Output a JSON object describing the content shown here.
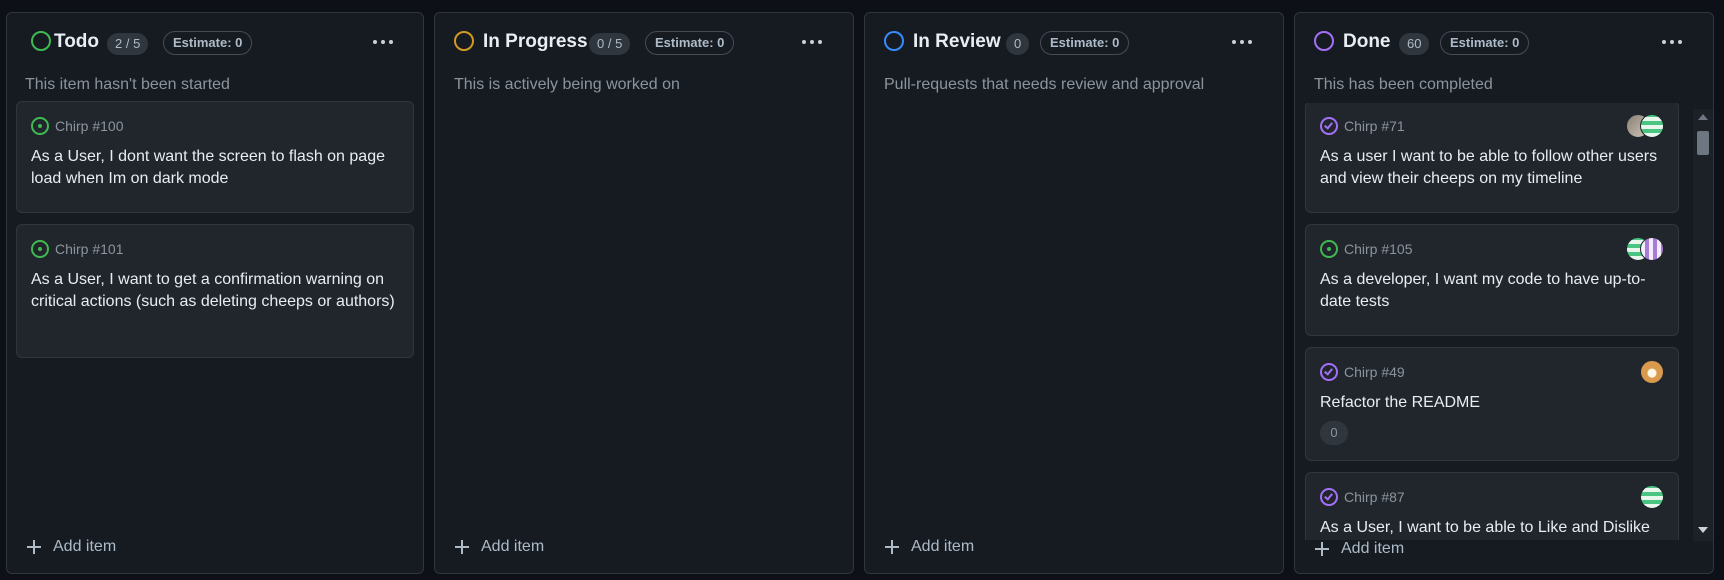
{
  "columns": [
    {
      "title": "Todo",
      "count": "2 / 5",
      "estimate": "Estimate: 0",
      "description": "This item hasn't been started",
      "status_color": "#3fb950",
      "add_label": "Add item",
      "cards": [
        {
          "number": "Chirp #100",
          "title": "As a User, I dont want the screen to flash on page load when Im on dark mode",
          "state": "open"
        },
        {
          "number": "Chirp #101",
          "title": "As a User, I want to get a confirmation warning on critical actions (such as deleting cheeps or authors)",
          "state": "open"
        }
      ]
    },
    {
      "title": "In Progress",
      "count": "0 / 5",
      "estimate": "Estimate: 0",
      "description": "This is actively being worked on",
      "status_color": "#d29922",
      "add_label": "Add item",
      "cards": []
    },
    {
      "title": "In Review",
      "count": "0",
      "estimate": "Estimate: 0",
      "description": "Pull-requests that needs review and approval",
      "status_color": "#388bfd",
      "add_label": "Add item",
      "cards": []
    },
    {
      "title": "Done",
      "count": "60",
      "estimate": "Estimate: 0",
      "description": "This has been completed",
      "status_color": "#a371f7",
      "add_label": "Add item",
      "cards": [
        {
          "number": "Chirp #71",
          "title": "As a user I want to be able to follow other users and view their cheeps on my timeline",
          "state": "done",
          "avatars": [
            "photo",
            "green"
          ]
        },
        {
          "number": "Chirp #105",
          "title": "As a developer, I want my code to have up-to-date tests",
          "state": "open",
          "avatars": [
            "green",
            "purple"
          ]
        },
        {
          "number": "Chirp #49",
          "title": "Refactor the README",
          "state": "done",
          "avatars": [
            "orange"
          ],
          "sub_count": "0"
        },
        {
          "number": "Chirp #87",
          "title": "As a User, I want to be able to Like and Dislike",
          "state": "done",
          "avatars": [
            "green"
          ]
        }
      ]
    }
  ]
}
